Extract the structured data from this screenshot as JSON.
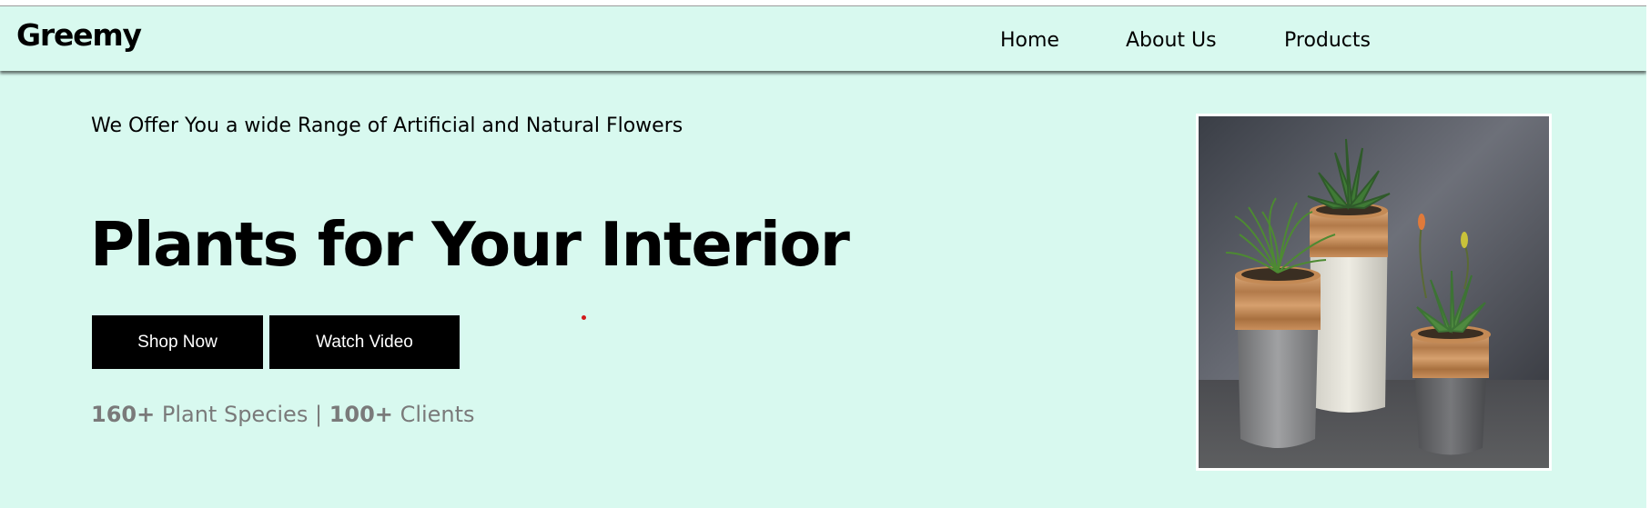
{
  "nav": {
    "brand": "Greemy",
    "links": [
      {
        "label": "Home"
      },
      {
        "label": "About Us"
      },
      {
        "label": "Products"
      }
    ]
  },
  "hero": {
    "tagline": "We Offer You a wide Range of Artificial and Natural Flowers",
    "headline": "Plants for Your Interior",
    "buttons": {
      "shop_now": "Shop Now",
      "watch_video": "Watch Video"
    },
    "stats": {
      "species_count": "160+",
      "species_label": "Plant Species",
      "separator": "|",
      "clients_count": "100+",
      "clients_label": "Clients"
    },
    "image": {
      "subject": "three-potted-plants-photo"
    }
  },
  "colors": {
    "background": "#d8f9ef",
    "text": "#000000",
    "button_bg": "#000000",
    "button_text": "#ffffff",
    "stats_text": "#7a7a7a",
    "cursor_dot": "#d11a1a"
  }
}
